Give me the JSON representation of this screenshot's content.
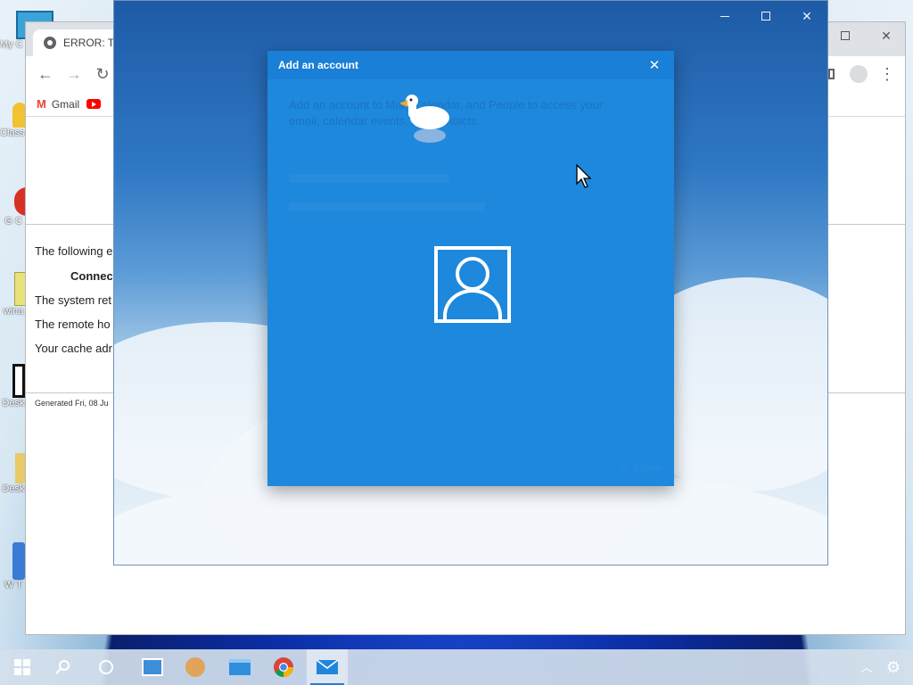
{
  "desktop": {
    "icons": [
      {
        "label": "My C",
        "icon": "computer-icon"
      },
      {
        "label": "Class",
        "icon": "classroom-icon"
      },
      {
        "label": "G C",
        "icon": "chrome-shortcut-icon"
      },
      {
        "label": "wina",
        "icon": "archive-icon"
      },
      {
        "label": "Desk",
        "icon": "qr-file-icon"
      },
      {
        "label": "Desk",
        "icon": "folder-icon"
      },
      {
        "label": "W T",
        "icon": "shortcut-icon"
      }
    ]
  },
  "browser": {
    "tab_title": "ERROR: Th",
    "bookmarks": [
      "Gmail"
    ],
    "error": {
      "line1": "The following e",
      "line2": "Connec",
      "line3": "The system ret",
      "line4": "The remote ho",
      "line5": "Your cache adr"
    },
    "generated": "Generated Fri, 08 Ju"
  },
  "dialog": {
    "title": "Add an account",
    "description": "Add an account to Mail, Calendar, and People to access your email, calendar events, and contacts.",
    "close_label": "Close",
    "close_icon": "✕"
  },
  "taskbar": {
    "items": [
      "start-icon",
      "search-icon",
      "task-view-icon",
      "control-panel-icon",
      "users-icon",
      "explorer-icon",
      "chrome-icon",
      "mail-icon"
    ]
  },
  "colors": {
    "dialog_bg": "#1e88dc",
    "title_bar": "#1a7fd6"
  }
}
